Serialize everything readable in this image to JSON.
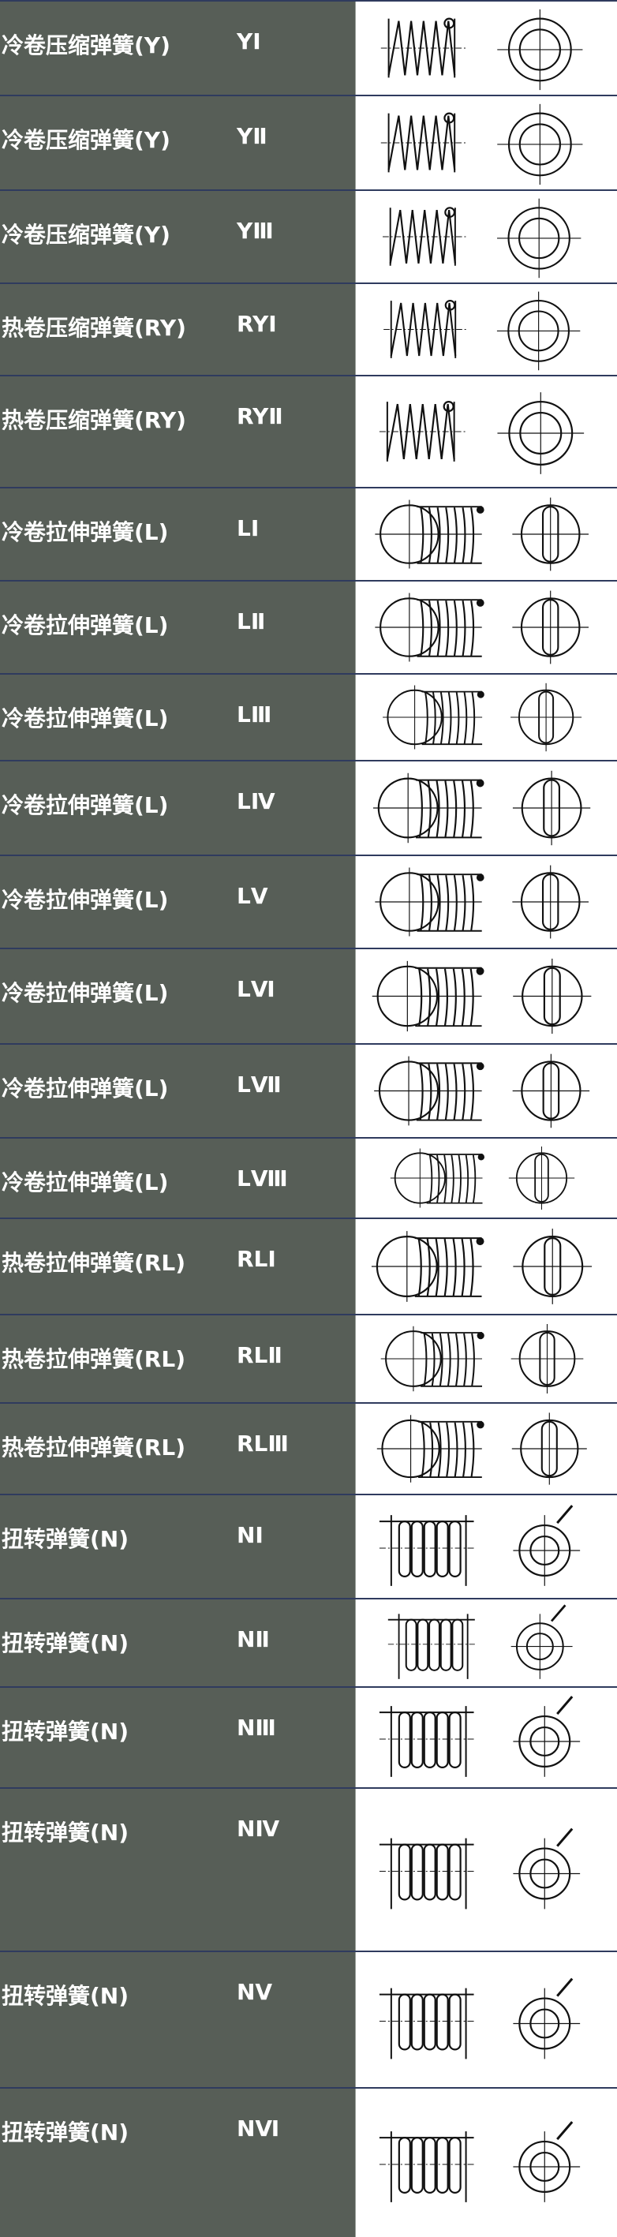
{
  "rows": [
    {
      "name": "冷卷压缩弹簧(Y)",
      "code": "YⅠ",
      "icon": "compression-spring-icon"
    },
    {
      "name": "冷卷压缩弹簧(Y)",
      "code": "YⅡ",
      "icon": "compression-spring-icon"
    },
    {
      "name": "冷卷压缩弹簧(Y)",
      "code": "YⅢ",
      "icon": "compression-spring-icon"
    },
    {
      "name": "热卷压缩弹簧(RY)",
      "code": "RYⅠ",
      "icon": "compression-spring-icon"
    },
    {
      "name": "热卷压缩弹簧(RY)",
      "code": "RYⅡ",
      "icon": "compression-spring-icon"
    },
    {
      "name": "冷卷拉伸弹簧(L)",
      "code": "LⅠ",
      "icon": "extension-spring-icon"
    },
    {
      "name": "冷卷拉伸弹簧(L)",
      "code": "LⅡ",
      "icon": "extension-spring-icon"
    },
    {
      "name": "冷卷拉伸弹簧(L)",
      "code": "LⅢ",
      "icon": "extension-spring-icon"
    },
    {
      "name": "冷卷拉伸弹簧(L)",
      "code": "LⅣ",
      "icon": "extension-spring-icon"
    },
    {
      "name": "冷卷拉伸弹簧(L)",
      "code": "LⅤ",
      "icon": "extension-spring-icon"
    },
    {
      "name": "冷卷拉伸弹簧(L)",
      "code": "LⅥ",
      "icon": "extension-spring-icon"
    },
    {
      "name": "冷卷拉伸弹簧(L)",
      "code": "LⅦ",
      "icon": "extension-spring-icon"
    },
    {
      "name": "冷卷拉伸弹簧(L)",
      "code": "LⅧ",
      "icon": "extension-spring-icon"
    },
    {
      "name": "热卷拉伸弹簧(RL)",
      "code": "RLⅠ",
      "icon": "extension-spring-icon"
    },
    {
      "name": "热卷拉伸弹簧(RL)",
      "code": "RLⅡ",
      "icon": "extension-spring-icon"
    },
    {
      "name": "热卷拉伸弹簧(RL)",
      "code": "RLⅢ",
      "icon": "extension-spring-icon"
    },
    {
      "name": "扭转弹簧(N)",
      "code": "NⅠ",
      "icon": "torsion-spring-icon"
    },
    {
      "name": "扭转弹簧(N)",
      "code": "NⅡ",
      "icon": "torsion-spring-icon"
    },
    {
      "name": "扭转弹簧(N)",
      "code": "NⅢ",
      "icon": "torsion-spring-icon"
    },
    {
      "name": "扭转弹簧(N)",
      "code": "NⅣ",
      "icon": "torsion-spring-icon"
    },
    {
      "name": "扭转弹簧(N)",
      "code": "NⅤ",
      "icon": "torsion-spring-icon"
    },
    {
      "name": "扭转弹簧(N)",
      "code": "NⅥ",
      "icon": "torsion-spring-icon"
    }
  ]
}
